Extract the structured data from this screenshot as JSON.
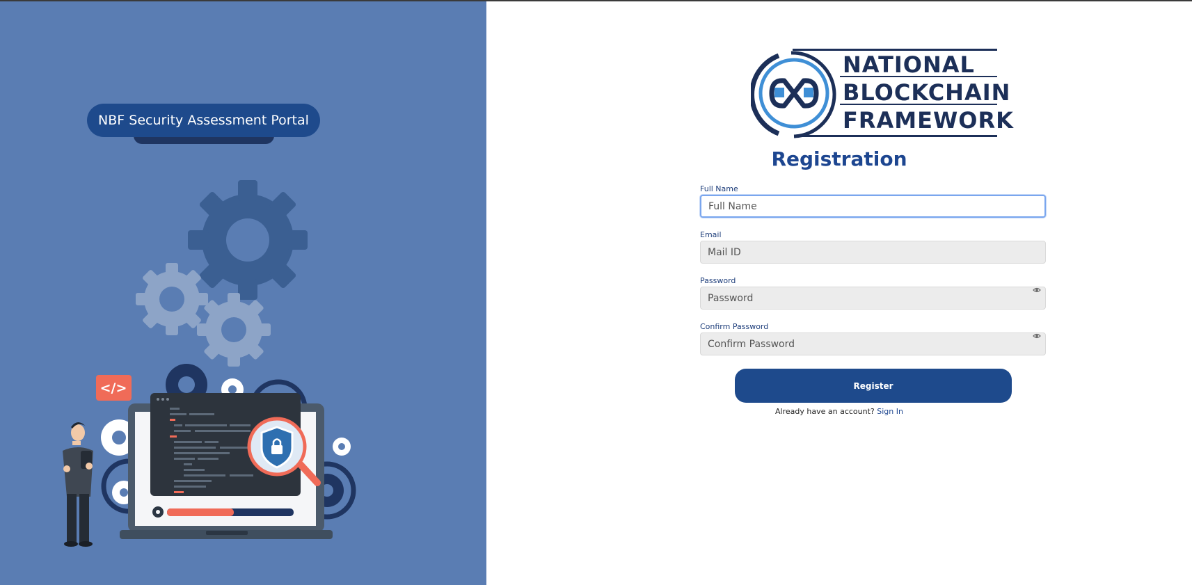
{
  "left_panel": {
    "portal_title": "NBF Security Assessment Portal",
    "illustration": {
      "code_tag": "</>",
      "icons": [
        "gear-icon",
        "shield-lock-icon",
        "magnifier-icon",
        "laptop-icon",
        "person-icon"
      ]
    }
  },
  "logo": {
    "line1": "NATIONAL",
    "line2": "BLOCKCHAIN",
    "line3": "FRAMEWORK"
  },
  "form": {
    "title": "Registration",
    "full_name": {
      "label": "Full Name",
      "placeholder": "Full Name"
    },
    "email": {
      "label": "Email",
      "placeholder": "Mail ID"
    },
    "password": {
      "label": "Password",
      "placeholder": "Password"
    },
    "confirm_password": {
      "label": "Confirm Password",
      "placeholder": "Confirm Password"
    },
    "register_label": "Register",
    "signin_prompt": "Already have an account?",
    "signin_link": "Sign In"
  },
  "colors": {
    "panel_blue": "#5a7db3",
    "brand_navy": "#1e4a8c",
    "title_blue": "#1d4690",
    "logo_navy": "#1c2f58",
    "logo_light_blue": "#3f8fd6",
    "accent_orange": "#f06b58"
  }
}
